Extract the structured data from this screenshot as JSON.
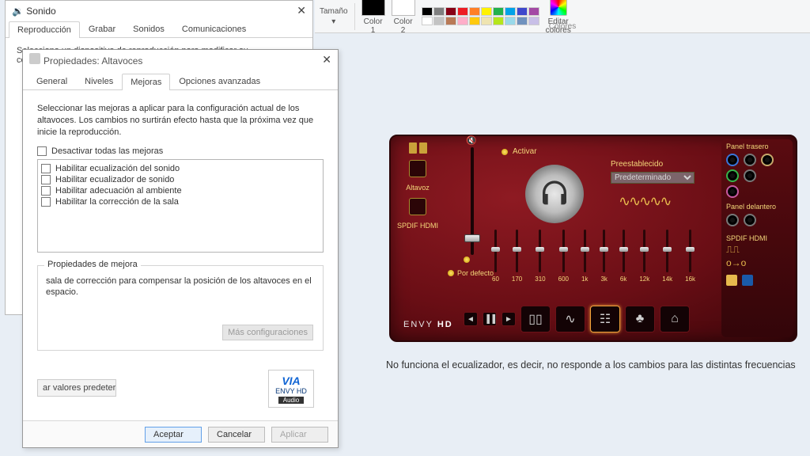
{
  "ribbon": {
    "size_label": "Tamaño",
    "color1": "Color\n1",
    "color2": "Color\n2",
    "edit_colors": "Editar\ncolores",
    "group_label": "Colores",
    "palette": [
      "#000",
      "#7f7f7f",
      "#880015",
      "#ed1c24",
      "#ff7f27",
      "#fff200",
      "#22b14c",
      "#00a2e8",
      "#3f48cc",
      "#a349a4",
      "#fff",
      "#c3c3c3",
      "#b97a57",
      "#ffaec9",
      "#ffc90e",
      "#efe4b0",
      "#b5e61d",
      "#99d9ea",
      "#7092be",
      "#c8bfe7"
    ]
  },
  "sound_dialog": {
    "title": "Sonido",
    "tabs": [
      "Reproducción",
      "Grabar",
      "Sonidos",
      "Comunicaciones"
    ],
    "active_tab": 0,
    "body_intro": "Selecciona un dispositivo de reproducción para modificar su configuración:"
  },
  "props_dialog": {
    "title": "Propiedades: Altavoces",
    "tabs": [
      "General",
      "Niveles",
      "Mejoras",
      "Opciones avanzadas"
    ],
    "active_tab": 2,
    "intro": "Seleccionar las mejoras a aplicar para la configuración actual de los altavoces. Los cambios no surtirán efecto hasta que la próxima vez que inicie la reproducción.",
    "disable_all": "Desactivar todas las mejoras",
    "enhancements": [
      "Habilitar ecualización del sonido",
      "Habilitar ecualizador de sonido",
      "Habilitar adecuación al ambiente",
      "Habilitar la corrección de la sala"
    ],
    "group_legend": "Propiedades de mejora",
    "group_text": "sala de corrección para compensar la posición de los altavoces en el espacio.",
    "more_btn": "Más configuraciones",
    "restore_btn": "ar valores predeterr",
    "brand_line1": "ENVY HD",
    "brand_audio": "Audio",
    "ok": "Aceptar",
    "cancel": "Cancelar",
    "apply": "Aplicar"
  },
  "audio_panel": {
    "speaker": "Altavoz",
    "spdif": "SPDIF HDMI",
    "activate": "Activar",
    "preset_label": "Preestablecido",
    "preset_value": "Predeterminado",
    "default": "Por defecto",
    "eq_bands": [
      "60",
      "170",
      "310",
      "600",
      "1k",
      "3k",
      "6k",
      "12k",
      "14k",
      "16k"
    ],
    "logo": "ENVY HD",
    "rear_panel": "Panel trasero",
    "front_panel": "Panel delantero",
    "spdif2": "SPDIF HDMI"
  },
  "caption": "No funciona el ecualizador, es decir, no responde a los cambios para las distintas frecuencias"
}
